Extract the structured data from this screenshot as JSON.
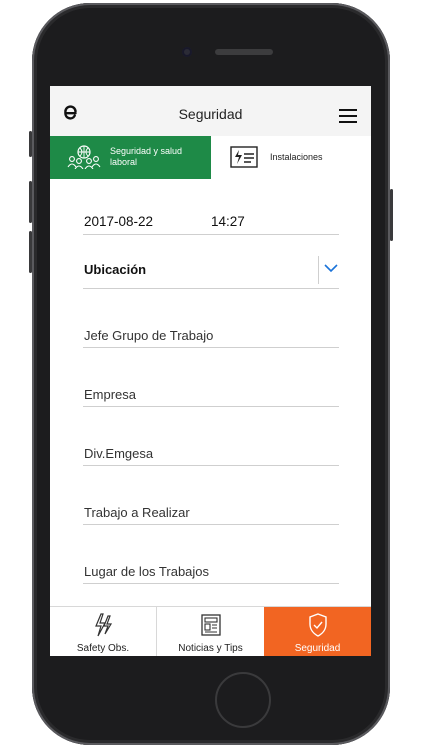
{
  "header": {
    "title": "Seguridad"
  },
  "tabs": [
    {
      "label": "Seguridad y salud laboral",
      "active": true
    },
    {
      "label": "Instalaciones",
      "active": false
    }
  ],
  "form": {
    "date": "2017-08-22",
    "time": "14:27",
    "location_label": "Ubicación",
    "fields": [
      "Jefe Grupo de Trabajo",
      "Empresa",
      "Div.Emgesa",
      "Trabajo a Realizar",
      "Lugar de los Trabajos"
    ]
  },
  "bottom_nav": [
    {
      "label": "Safety Obs.",
      "icon": "lightning-icon"
    },
    {
      "label": "Noticias y Tips",
      "icon": "news-icon"
    },
    {
      "label": "Seguridad",
      "icon": "shield-check-icon",
      "active": true
    }
  ],
  "colors": {
    "accent_green": "#1e8a47",
    "accent_orange": "#f26522",
    "chevron_blue": "#1a73d9"
  }
}
